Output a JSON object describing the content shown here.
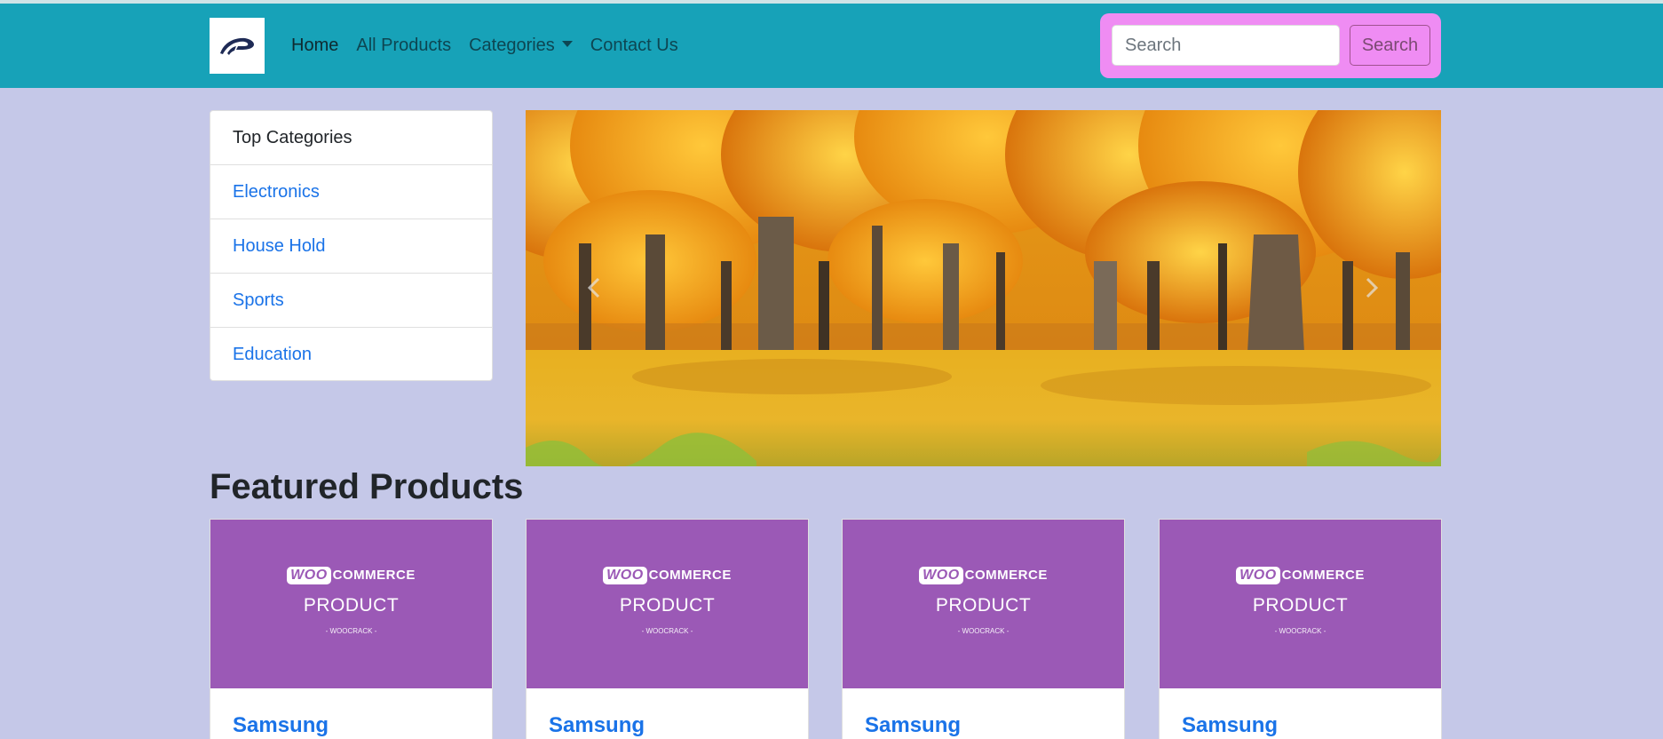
{
  "navbar": {
    "brand_icon": "brand-logo-icon",
    "links": [
      {
        "label": "Home",
        "active": true
      },
      {
        "label": "All Products",
        "active": false
      },
      {
        "label": "Categories",
        "dropdown": true,
        "active": false
      },
      {
        "label": "Contact Us",
        "active": false
      }
    ],
    "search": {
      "placeholder": "Search",
      "value": "",
      "button_label": "Search"
    }
  },
  "sidebar": {
    "header": "Top Categories",
    "items": [
      {
        "label": "Electronics"
      },
      {
        "label": "House Hold"
      },
      {
        "label": "Sports"
      },
      {
        "label": "Education"
      }
    ]
  },
  "carousel": {
    "prev_icon": "chevron-left-icon",
    "next_icon": "chevron-right-icon"
  },
  "featured": {
    "title": "Featured Products",
    "products": [
      {
        "image_logo": "WOO",
        "image_logo_suffix": "COMMERCE",
        "image_text": "PRODUCT",
        "image_sub": "- WOOCRACK -",
        "name": "Samsung"
      },
      {
        "image_logo": "WOO",
        "image_logo_suffix": "COMMERCE",
        "image_text": "PRODUCT",
        "image_sub": "- WOOCRACK -",
        "name": "Samsung"
      },
      {
        "image_logo": "WOO",
        "image_logo_suffix": "COMMERCE",
        "image_text": "PRODUCT",
        "image_sub": "- WOOCRACK -",
        "name": "Samsung"
      },
      {
        "image_logo": "WOO",
        "image_logo_suffix": "COMMERCE",
        "image_text": "PRODUCT",
        "image_sub": "- WOOCRACK -",
        "name": "Samsung"
      }
    ]
  },
  "colors": {
    "navbar": "#17a2b8",
    "page_background": "#c5c8e8",
    "search_highlight": "#ef8cf3",
    "link": "#1a73e8",
    "product_image": "#9b59b6"
  }
}
